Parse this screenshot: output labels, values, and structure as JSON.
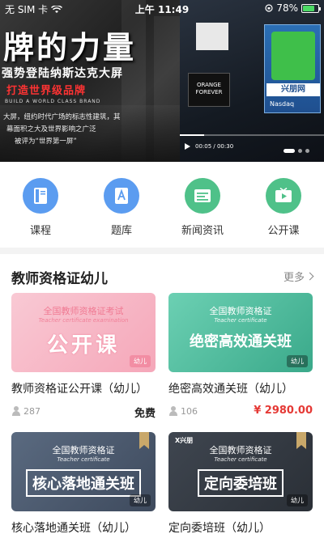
{
  "status_bar": {
    "carrier": "无 SIM 卡",
    "time": "上午 11:49",
    "battery": "78%",
    "battery_level": 0.78
  },
  "banner": {
    "title": "牌的力量",
    "sub1": "强势登陆纳斯达克大屏",
    "sub2": "打造世界级品牌",
    "en": "BUILD A WORLD CLASS BRAND",
    "desc": [
      "大屏，纽约时代广场的标志性建筑，其",
      "幕面积之大及世界影响之广泛",
      "被评为“世界第一屏”"
    ],
    "screen_text_1": "ORANGE",
    "screen_text_2": "FOREVER",
    "brand_logo": "兴朋网",
    "nasdaq": "Nasdaq",
    "video_time": "00:05 / 00:30",
    "slide_count": 3,
    "active_slide": 1
  },
  "quick_nav": [
    {
      "label": "课程",
      "icon": "book-icon",
      "color": "#5b9cf0"
    },
    {
      "label": "题库",
      "icon": "question-bank-icon",
      "color": "#5b9cf0"
    },
    {
      "label": "新闻资讯",
      "icon": "news-icon",
      "color": "#4fc189"
    },
    {
      "label": "公开课",
      "icon": "video-play-icon",
      "color": "#4fc189"
    }
  ],
  "section": {
    "title": "教师资格证幼儿",
    "more": "更多"
  },
  "courses": [
    {
      "thumb_line1": "全国教师资格证考试",
      "thumb_line2": "Teacher certificate examination",
      "thumb_big": "公开课",
      "badge": "幼儿",
      "title": "教师资格证公开课（幼儿）",
      "students": "287",
      "price": "免费"
    },
    {
      "thumb_line1": "全国教师资格证",
      "thumb_line2": "Teacher certificate",
      "thumb_big": "绝密高效通关班",
      "badge": "幼儿",
      "title": "绝密高效通关班（幼儿）",
      "students": "106",
      "price": "¥ 2980.00"
    },
    {
      "thumb_line1": "全国教师资格证",
      "thumb_line2": "Teacher certificate",
      "thumb_big": "核心落地通关班",
      "badge": "幼儿",
      "title": "核心落地通关班（幼儿）"
    },
    {
      "brand": "X兴朋",
      "thumb_line1": "全国教师资格证",
      "thumb_line2": "Teacher certificate",
      "thumb_big": "定向委培班",
      "badge": "幼儿",
      "title": "定向委培班（幼儿）"
    }
  ],
  "colors": {
    "accent_blue": "#5b9cf0",
    "accent_green": "#4fc189",
    "price_red": "#e53935"
  }
}
